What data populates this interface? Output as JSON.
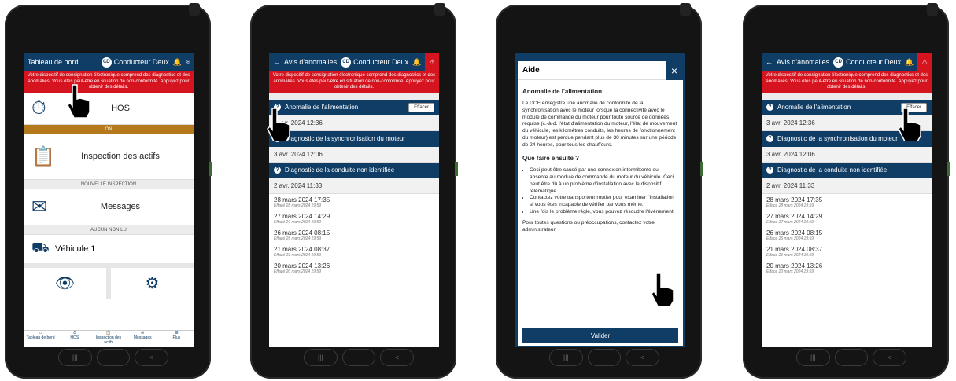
{
  "colors": {
    "primary": "#0f3d66",
    "alert": "#d6141f",
    "hos_on": "#b4791b"
  },
  "banner_text": "Votre dispositif de consignation électronique comprend des diagnostics et des anomalies. Vous êtes peut-être en situation de non-conformité. Appuyez pour obtenir des détails.",
  "driver": {
    "initials": "CD",
    "name": "Conducteur Deux"
  },
  "screen1": {
    "title": "Tableau de bord",
    "hos": {
      "label": "HOS",
      "status": "ON"
    },
    "inspection": {
      "label": "Inspection des actifs",
      "status": "NOUVELLE INSPECTION"
    },
    "messages": {
      "label": "Messages",
      "status": "AUCUN NON LU"
    },
    "vehicle": {
      "label": "Véhicule 1"
    },
    "nav": [
      "Tableau de bord",
      "HOS",
      "Inspection des actifs",
      "Messages",
      "Plus"
    ]
  },
  "anomalies": {
    "title": "Avis d'anomalies",
    "erase_label": "Effacer",
    "sections": [
      {
        "label": "Anomalie de l'alimentation",
        "date": "3 avr. 2024 12:36"
      },
      {
        "label": "Diagnostic de la synchronisation du moteur",
        "date": "3 avr. 2024 12:06"
      },
      {
        "label": "Diagnostic de la conduite non identifiée",
        "date": "2 avr. 2024 11:33"
      }
    ],
    "history": [
      {
        "date": "28 mars 2024 17:35",
        "sub": "Effacé 28 mars 2024 19:59"
      },
      {
        "date": "27 mars 2024 14:29",
        "sub": "Effacé 27 mars 2024 19:59"
      },
      {
        "date": "26 mars 2024 08:15",
        "sub": "Effacé 26 mars 2024 19:59"
      },
      {
        "date": "21 mars 2024 08:37",
        "sub": "Effacé 21 mars 2024 19:59"
      },
      {
        "date": "20 mars 2024 13:26",
        "sub": "Effacé 20 mars 2024 19:59"
      }
    ]
  },
  "help": {
    "title": "Aide",
    "close": "×",
    "heading": "Anomalie de l'alimentation:",
    "body": "Le DCE enregistre une anomalie de conformité de la synchronisation avec le moteur lorsque la connectivité avec le module de commande du moteur pour toute source de données requise (c.-à-d. l'état d'alimentation du moteur, l'état de mouvement du véhicule, les kilomètres conduits, les heures de fonctionnement du moteur) est perdue pendant plus de 30 minutes sur une période de 24 heures, pour tous les chauffeurs.",
    "next_heading": "Que faire ensuite ?",
    "bullets": [
      "Ceci peut être causé par une connexion intermittente ou absente au module de commande du moteur du véhicule. Ceci peut être dû à un problème d'installation avec le dispositif télématique.",
      "Contactez votre transporteur routier pour examiner l'installation si vous êtes incapable de vérifier par vous même.",
      "Une fois le problème réglé, vous pouvez résoudre l'événement."
    ],
    "footer": "Pour toutes questions ou préoccupations, contactez votre administrateur.",
    "validate": "Valider"
  }
}
